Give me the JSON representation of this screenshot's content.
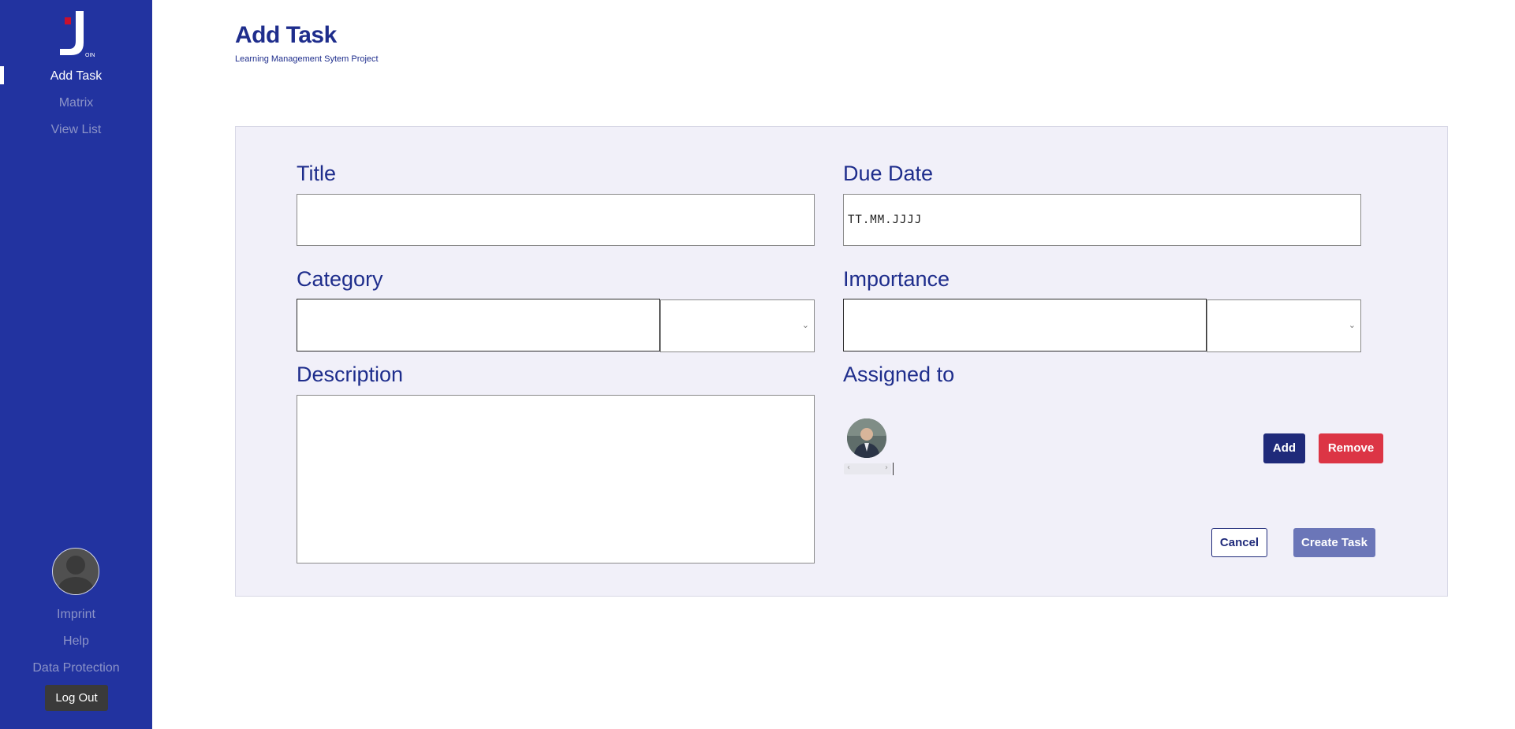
{
  "sidebar": {
    "logo_text": "OIN",
    "nav": [
      {
        "label": "Add Task",
        "active": true
      },
      {
        "label": "Matrix",
        "active": false
      },
      {
        "label": "View List",
        "active": false
      }
    ],
    "footer_links": [
      "Imprint",
      "Help",
      "Data Protection"
    ],
    "logout_label": "Log Out"
  },
  "header": {
    "title": "Add Task",
    "subtitle": "Learning Management Sytem Project"
  },
  "form": {
    "title_label": "Title",
    "title_value": "",
    "due_date_label": "Due Date",
    "due_date_placeholder": "TT.MM.JJJJ",
    "category_label": "Category",
    "category_value": "",
    "importance_label": "Importance",
    "importance_value": "",
    "description_label": "Description",
    "description_value": "",
    "assigned_label": "Assigned to",
    "add_label": "Add",
    "remove_label": "Remove",
    "cancel_label": "Cancel",
    "create_label": "Create Task"
  },
  "colors": {
    "sidebar_bg": "#2233a0",
    "accent": "#1e2d8c",
    "danger": "#dc3545",
    "create_button": "#6b76b8",
    "card_bg": "#f1f0f9"
  },
  "icons": {
    "logo": "join-logo",
    "select_arrow": "chevron-down-icon",
    "user_placeholder": "user-avatar-icon"
  }
}
